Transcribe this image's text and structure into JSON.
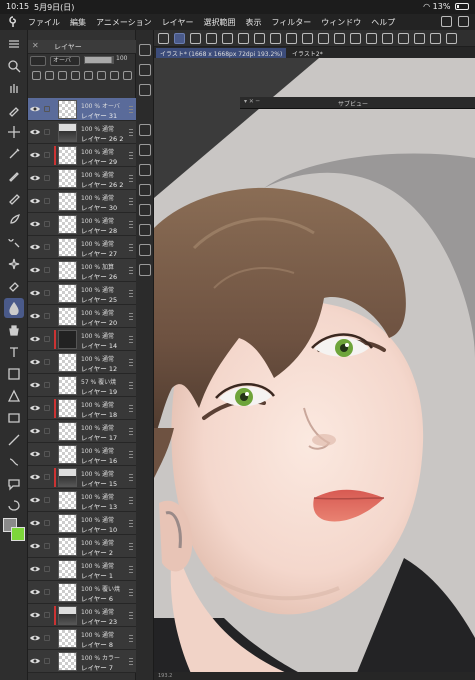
{
  "status_bar": {
    "time": "10:15",
    "date": "5月9日(日)",
    "battery": "13%"
  },
  "menu": {
    "items": [
      "ファイル",
      "編集",
      "アニメーション",
      "レイヤー",
      "選択範囲",
      "表示",
      "フィルター",
      "ウィンドウ",
      "ヘルプ"
    ]
  },
  "layer_panel": {
    "title": "レイヤー",
    "blend_mode": "オーバ",
    "opacity": "100",
    "layers": [
      {
        "line1": "100 % オーバ",
        "name": "レイヤー 31",
        "thumb": "pattern",
        "selected": true,
        "clip": false
      },
      {
        "line1": "100 % 通常",
        "name": "レイヤー 26 2",
        "thumb": "fig",
        "selected": false,
        "clip": false
      },
      {
        "line1": "100 % 通常",
        "name": "レイヤー 29",
        "thumb": "pattern",
        "selected": false,
        "clip": true
      },
      {
        "line1": "100 % 通常",
        "name": "レイヤー 26 2",
        "thumb": "pattern",
        "selected": false,
        "clip": false
      },
      {
        "line1": "100 % 通常",
        "name": "レイヤー 30",
        "thumb": "pattern",
        "selected": false,
        "clip": false
      },
      {
        "line1": "100 % 通常",
        "name": "レイヤー 28",
        "thumb": "pattern",
        "selected": false,
        "clip": false
      },
      {
        "line1": "100 % 通常",
        "name": "レイヤー 27",
        "thumb": "pattern",
        "selected": false,
        "clip": false
      },
      {
        "line1": "100 % 加算",
        "name": "レイヤー 26",
        "thumb": "pattern",
        "selected": false,
        "clip": false
      },
      {
        "line1": "100 % 通常",
        "name": "レイヤー 25",
        "thumb": "pattern",
        "selected": false,
        "clip": false
      },
      {
        "line1": "100 % 通常",
        "name": "レイヤー 20",
        "thumb": "pattern",
        "selected": false,
        "clip": false
      },
      {
        "line1": "100 % 通常",
        "name": "レイヤー 14",
        "thumb": "dark",
        "selected": false,
        "clip": true
      },
      {
        "line1": "100 % 通常",
        "name": "レイヤー 12",
        "thumb": "pattern",
        "selected": false,
        "clip": false
      },
      {
        "line1": "57 % 覆い焼",
        "name": "レイヤー 19",
        "thumb": "pattern",
        "selected": false,
        "clip": false
      },
      {
        "line1": "100 % 通常",
        "name": "レイヤー 18",
        "thumb": "pattern",
        "selected": false,
        "clip": true
      },
      {
        "line1": "100 % 通常",
        "name": "レイヤー 17",
        "thumb": "pattern",
        "selected": false,
        "clip": false
      },
      {
        "line1": "100 % 通常",
        "name": "レイヤー 16",
        "thumb": "pattern",
        "selected": false,
        "clip": false
      },
      {
        "line1": "100 % 通常",
        "name": "レイヤー 15",
        "thumb": "fig",
        "selected": false,
        "clip": true
      },
      {
        "line1": "100 % 通常",
        "name": "レイヤー 13",
        "thumb": "pattern",
        "selected": false,
        "clip": false
      },
      {
        "line1": "100 % 通常",
        "name": "レイヤー 10",
        "thumb": "pattern",
        "selected": false,
        "clip": false
      },
      {
        "line1": "100 % 通常",
        "name": "レイヤー 2",
        "thumb": "pattern",
        "selected": false,
        "clip": false
      },
      {
        "line1": "100 % 通常",
        "name": "レイヤー 1",
        "thumb": "pattern",
        "selected": false,
        "clip": false
      },
      {
        "line1": "100 % 覆い焼",
        "name": "レイヤー 6",
        "thumb": "pattern",
        "selected": false,
        "clip": false
      },
      {
        "line1": "100 % 通常",
        "name": "レイヤー 23",
        "thumb": "fig",
        "selected": false,
        "clip": true
      },
      {
        "line1": "100 % 通常",
        "name": "レイヤー 8",
        "thumb": "pattern",
        "selected": false,
        "clip": false
      },
      {
        "line1": "100 % カラー",
        "name": "レイヤー 7",
        "thumb": "pattern",
        "selected": false,
        "clip": false
      }
    ]
  },
  "document_tabs": [
    {
      "label": "イラスト* (1668 x 1668px 72dpi 193.2%)",
      "active": true
    },
    {
      "label": "イラスト2*",
      "active": false
    }
  ],
  "subview": {
    "title": "サブビュー"
  },
  "scrollbar": {
    "zoom_readout": "193.2"
  },
  "colors": {
    "main": "#8a8a8a",
    "sub": "#7dd63a",
    "accent": "#5a6b9a"
  }
}
